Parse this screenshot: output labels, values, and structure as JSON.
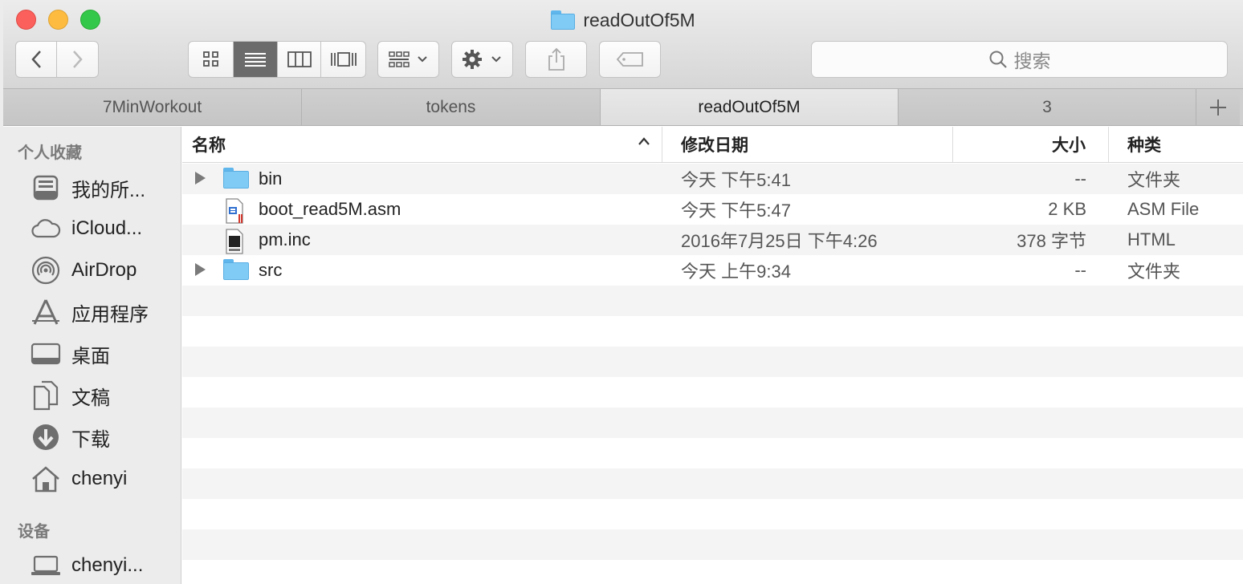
{
  "window": {
    "title": "readOutOf5M"
  },
  "toolbar": {
    "back": "back",
    "forward": "forward",
    "view_modes": [
      "icon-view",
      "list-view",
      "column-view",
      "cover-flow-view"
    ],
    "active_view": "list-view",
    "search_placeholder": "搜索"
  },
  "tabs": [
    {
      "label": "7MinWorkout",
      "active": false
    },
    {
      "label": "tokens",
      "active": false
    },
    {
      "label": "readOutOf5M",
      "active": true
    },
    {
      "label": "3",
      "active": false
    }
  ],
  "sidebar": {
    "favorites_header": "个人收藏",
    "favorites": [
      {
        "label": "我的所...",
        "icon": "all-my-files-icon"
      },
      {
        "label": "iCloud...",
        "icon": "icloud-icon"
      },
      {
        "label": "AirDrop",
        "icon": "airdrop-icon"
      },
      {
        "label": "应用程序",
        "icon": "applications-icon"
      },
      {
        "label": "桌面",
        "icon": "desktop-icon"
      },
      {
        "label": "文稿",
        "icon": "documents-icon"
      },
      {
        "label": "下载",
        "icon": "downloads-icon"
      },
      {
        "label": "chenyi",
        "icon": "home-icon"
      }
    ],
    "devices_header": "设备",
    "devices": [
      {
        "label": "chenyi...",
        "icon": "laptop-icon"
      }
    ]
  },
  "list": {
    "columns": {
      "name": "名称",
      "date": "修改日期",
      "size": "大小",
      "kind": "种类"
    },
    "rows": [
      {
        "name": "bin",
        "date": "今天 下午5:41",
        "size": "--",
        "kind": "文件夹",
        "type": "folder"
      },
      {
        "name": "boot_read5M.asm",
        "date": "今天 下午5:47",
        "size": "2 KB",
        "kind": "ASM File",
        "type": "asm"
      },
      {
        "name": "pm.inc",
        "date": "2016年7月25日 下午4:26",
        "size": "378 字节",
        "kind": "HTML",
        "type": "html"
      },
      {
        "name": "src",
        "date": "今天 上午9:34",
        "size": "--",
        "kind": "文件夹",
        "type": "folder"
      }
    ]
  },
  "colors": {
    "close": "#fc605c",
    "minimize": "#fdbc40",
    "maximize": "#34c84a",
    "folder": "#7fcbf5"
  }
}
